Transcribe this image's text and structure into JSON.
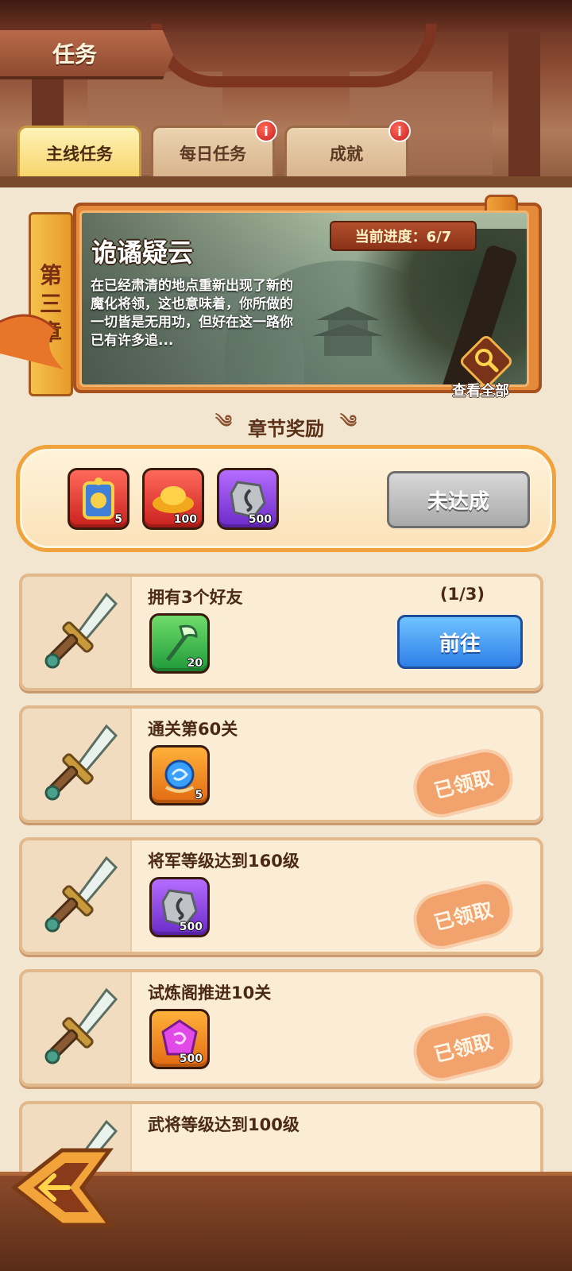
{
  "page": {
    "title": "任务"
  },
  "tabs": [
    {
      "label": "主线任务",
      "active": true,
      "badge": ""
    },
    {
      "label": "每日任务",
      "active": false,
      "badge": "i"
    },
    {
      "label": "成就",
      "active": false,
      "badge": "i"
    }
  ],
  "chapter": {
    "tag_chars": [
      "第",
      "三",
      "章"
    ],
    "title": "诡谲疑云",
    "description": "在已经肃清的地点重新出现了新的魔化将领，这也意味着，你所做的一切皆是无用功，但好在这一路你已有许多追...",
    "progress_text": "当前进度：6/7",
    "view_all_label": "查看全部"
  },
  "chapter_reward": {
    "header": "章节奖励",
    "items": [
      {
        "icon": "general-token-icon",
        "count": "5",
        "color": "#d83020"
      },
      {
        "icon": "gold-ingot-icon",
        "count": "100",
        "color": "#d83020"
      },
      {
        "icon": "iron-ore-icon",
        "count": "500",
        "color": "#7a34d8"
      }
    ],
    "button_label": "未达成"
  },
  "tasks": [
    {
      "name": "拥有3个好友",
      "progress": "(1/3)",
      "reward_icon": "green-weapon-icon",
      "reward_count": "20",
      "reward_color": "green",
      "action": "前往",
      "state": "go"
    },
    {
      "name": "通关第60关",
      "progress": "",
      "reward_icon": "blue-orb-icon",
      "reward_count": "5",
      "reward_color": "orange",
      "action": "已领取",
      "state": "claimed"
    },
    {
      "name": "将军等级达到160级",
      "progress": "",
      "reward_icon": "iron-ore-icon",
      "reward_count": "500",
      "reward_color": "purple",
      "action": "已领取",
      "state": "claimed"
    },
    {
      "name": "试炼阁推进10关",
      "progress": "",
      "reward_icon": "pink-crystal-icon",
      "reward_count": "500",
      "reward_color": "orange",
      "action": "已领取",
      "state": "claimed"
    },
    {
      "name": "武将等级达到100级",
      "progress": "",
      "reward_icon": "",
      "reward_count": "",
      "reward_color": "",
      "action": "",
      "state": "partial"
    }
  ],
  "colors": {
    "accent": "#f0a23c",
    "go_button": "#2f7fe8",
    "claimed_stamp": "#f0965a",
    "locked_button": "#a9a9a9"
  }
}
